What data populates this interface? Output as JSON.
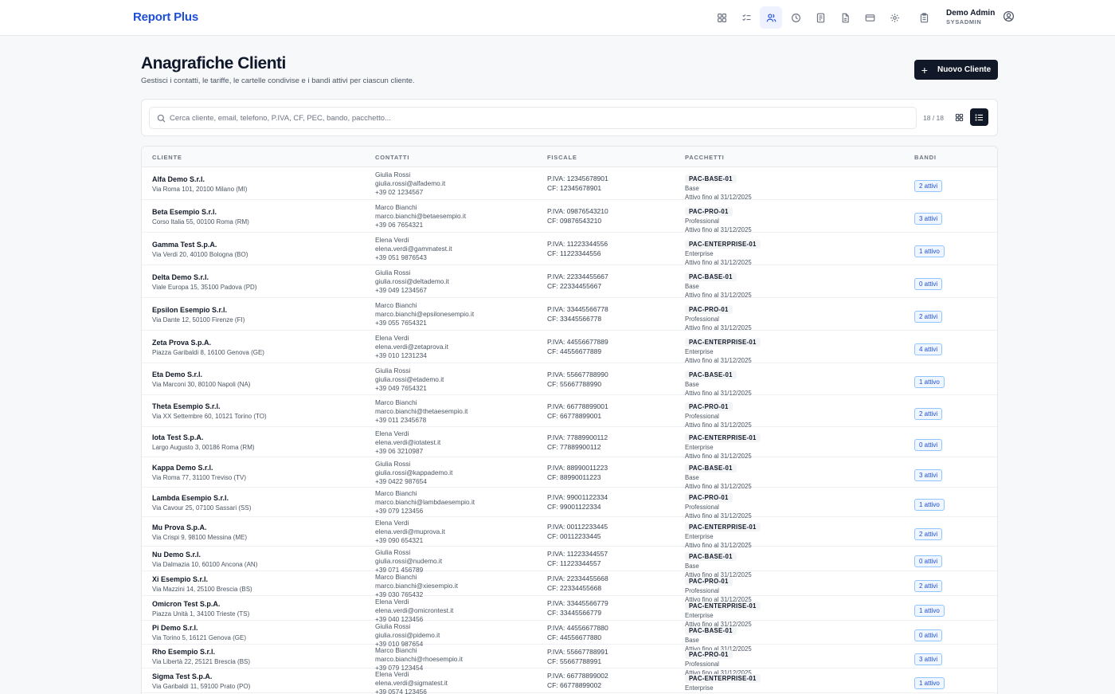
{
  "app": {
    "brand": "Report Plus",
    "user": {
      "name": "Demo Admin",
      "role": "SYSADMIN"
    },
    "nav_icons": [
      "dashboard-icon",
      "checklist-icon",
      "users-icon",
      "clock-icon",
      "document-icon",
      "file-icon",
      "card-icon",
      "gear-icon",
      "clipboard-icon"
    ],
    "active_nav": "users-icon"
  },
  "header": {
    "title": "Anagrafiche Clienti",
    "subtitle": "Gestisci i contatti, le tariffe, le cartelle condivise e i bandi attivi per ciascun cliente.",
    "new_button": "Nuovo Cliente"
  },
  "search": {
    "placeholder": "Cerca cliente, email, telefono, P.IVA, CF, PEC, bando, pacchetto...",
    "value": "",
    "count": "18 / 18",
    "view": "list"
  },
  "colors": {
    "accent": "#1d4ed8",
    "dark": "#111827",
    "badge_bg": "#eff6ff",
    "badge_border": "#93c5fd"
  },
  "table": {
    "columns": [
      "CLIENTE",
      "CONTATTI",
      "FISCALE",
      "PACCHETTI",
      "BANDI"
    ],
    "rows": [
      {
        "name": "Alfa Demo S.r.l.",
        "address": "Via Roma 101, 20100 Milano (MI)",
        "contact": "Giulia Rossi",
        "email": "giulia.rossi@alfademo.it",
        "phone": "+39 02 1234567",
        "piva": "P.IVA: 12345678901",
        "cf": "CF: 12345678901",
        "pkg_code": "PAC-BASE-01",
        "pkg_name": "Base",
        "pkg_active": "Attivo fino al 31/12/2025",
        "bandi": "2 attivi"
      },
      {
        "name": "Beta Esempio S.r.l.",
        "address": "Corso Italia 55, 00100 Roma (RM)",
        "contact": "Marco Bianchi",
        "email": "marco.bianchi@betaesempio.it",
        "phone": "+39 06 7654321",
        "piva": "P.IVA: 09876543210",
        "cf": "CF: 09876543210",
        "pkg_code": "PAC-PRO-01",
        "pkg_name": "Professional",
        "pkg_active": "Attivo fino al 31/12/2025",
        "bandi": "3 attivi"
      },
      {
        "name": "Gamma Test S.p.A.",
        "address": "Via Verdi 20, 40100 Bologna (BO)",
        "contact": "Elena Verdi",
        "email": "elena.verdi@gammatest.it",
        "phone": "+39 051 9876543",
        "piva": "P.IVA: 11223344556",
        "cf": "CF: 11223344556",
        "pkg_code": "PAC-ENTERPRISE-01",
        "pkg_name": "Enterprise",
        "pkg_active": "Attivo fino al 31/12/2025",
        "bandi": "1 attivo"
      },
      {
        "name": "Delta Demo S.r.l.",
        "address": "Viale Europa 15, 35100 Padova (PD)",
        "contact": "Giulia Rossi",
        "email": "giulia.rossi@deltademo.it",
        "phone": "+39 049 1234567",
        "piva": "P.IVA: 22334455667",
        "cf": "CF: 22334455667",
        "pkg_code": "PAC-BASE-01",
        "pkg_name": "Base",
        "pkg_active": "Attivo fino al 31/12/2025",
        "bandi": "0 attivi"
      },
      {
        "name": "Epsilon Esempio S.r.l.",
        "address": "Via Dante 12, 50100 Firenze (FI)",
        "contact": "Marco Bianchi",
        "email": "marco.bianchi@epsilonesempio.it",
        "phone": "+39 055 7654321",
        "piva": "P.IVA: 33445566778",
        "cf": "CF: 33445566778",
        "pkg_code": "PAC-PRO-01",
        "pkg_name": "Professional",
        "pkg_active": "Attivo fino al 31/12/2025",
        "bandi": "2 attivi"
      },
      {
        "name": "Zeta Prova S.p.A.",
        "address": "Piazza Garibaldi 8, 16100 Genova (GE)",
        "contact": "Elena Verdi",
        "email": "elena.verdi@zetaprova.it",
        "phone": "+39 010 1231234",
        "piva": "P.IVA: 44556677889",
        "cf": "CF: 44556677889",
        "pkg_code": "PAC-ENTERPRISE-01",
        "pkg_name": "Enterprise",
        "pkg_active": "Attivo fino al 31/12/2025",
        "bandi": "4 attivi"
      },
      {
        "name": "Eta Demo S.r.l.",
        "address": "Via Marconi 30, 80100 Napoli (NA)",
        "contact": "Giulia Rossi",
        "email": "giulia.rossi@etademo.it",
        "phone": "+39 049 7654321",
        "piva": "P.IVA: 55667788990",
        "cf": "CF: 55667788990",
        "pkg_code": "PAC-BASE-01",
        "pkg_name": "Base",
        "pkg_active": "Attivo fino al 31/12/2025",
        "bandi": "1 attivo"
      },
      {
        "name": "Theta Esempio S.r.l.",
        "address": "Via XX Settembre 60, 10121 Torino (TO)",
        "contact": "Marco Bianchi",
        "email": "marco.bianchi@thetaesempio.it",
        "phone": "+39 011 2345678",
        "piva": "P.IVA: 66778899001",
        "cf": "CF: 66778899001",
        "pkg_code": "PAC-PRO-01",
        "pkg_name": "Professional",
        "pkg_active": "Attivo fino al 31/12/2025",
        "bandi": "2 attivi"
      },
      {
        "name": "Iota Test S.p.A.",
        "address": "Largo Augusto 3, 00186 Roma (RM)",
        "contact": "Elena Verdi",
        "email": "elena.verdi@iotatest.it",
        "phone": "+39 06 3210987",
        "piva": "P.IVA: 77889900112",
        "cf": "CF: 77889900112",
        "pkg_code": "PAC-ENTERPRISE-01",
        "pkg_name": "Enterprise",
        "pkg_active": "Attivo fino al 31/12/2025",
        "bandi": "0 attivi"
      },
      {
        "name": "Kappa Demo S.r.l.",
        "address": "Via Roma 77, 31100 Treviso (TV)",
        "contact": "Giulia Rossi",
        "email": "giulia.rossi@kappademo.it",
        "phone": "+39 0422 987654",
        "piva": "P.IVA: 88990011223",
        "cf": "CF: 88990011223",
        "pkg_code": "PAC-BASE-01",
        "pkg_name": "Base",
        "pkg_active": "Attivo fino al 31/12/2025",
        "bandi": "3 attivi"
      },
      {
        "name": "Lambda Esempio S.r.l.",
        "address": "Via Cavour 25, 07100 Sassari (SS)",
        "contact": "Marco Bianchi",
        "email": "marco.bianchi@lambdaesempio.it",
        "phone": "+39 079 123456",
        "piva": "P.IVA: 99001122334",
        "cf": "CF: 99001122334",
        "pkg_code": "PAC-PRO-01",
        "pkg_name": "Professional",
        "pkg_active": "Attivo fino al 31/12/2025",
        "bandi": "1 attivo"
      },
      {
        "name": "Mu Prova S.p.A.",
        "address": "Via Crispi 9, 98100 Messina (ME)",
        "contact": "Elena Verdi",
        "email": "elena.verdi@muprova.it",
        "phone": "+39 090 654321",
        "piva": "P.IVA: 00112233445",
        "cf": "CF: 00112233445",
        "pkg_code": "PAC-ENTERPRISE-01",
        "pkg_name": "Enterprise",
        "pkg_active": "Attivo fino al 31/12/2025",
        "bandi": "2 attivi"
      },
      {
        "name": "Nu Demo S.r.l.",
        "address": "Via Dalmazia 10, 60100 Ancona (AN)",
        "contact": "Giulia Rossi",
        "email": "giulia.rossi@nudemo.it",
        "phone": "+39 071 456789",
        "piva": "P.IVA: 11223344557",
        "cf": "CF: 11223344557",
        "pkg_code": "PAC-BASE-01",
        "pkg_name": "Base",
        "pkg_active": "Attivo fino al 31/12/2025",
        "bandi": "0 attivi"
      },
      {
        "name": "Xi Esempio S.r.l.",
        "address": "Via Mazzini 14, 25100 Brescia (BS)",
        "contact": "Marco Bianchi",
        "email": "marco.bianchi@xiesempio.it",
        "phone": "+39 030 765432",
        "piva": "P.IVA: 22334455668",
        "cf": "CF: 22334455668",
        "pkg_code": "PAC-PRO-01",
        "pkg_name": "Professional",
        "pkg_active": "Attivo fino al 31/12/2025",
        "bandi": "2 attivi"
      },
      {
        "name": "Omicron Test S.p.A.",
        "address": "Piazza Unità 1, 34100 Trieste (TS)",
        "contact": "Elena Verdi",
        "email": "elena.verdi@omicrontest.it",
        "phone": "+39 040 123456",
        "piva": "P.IVA: 33445566779",
        "cf": "CF: 33445566779",
        "pkg_code": "PAC-ENTERPRISE-01",
        "pkg_name": "Enterprise",
        "pkg_active": "Attivo fino al 31/12/2025",
        "bandi": "1 attivo"
      },
      {
        "name": "Pi Demo S.r.l.",
        "address": "Via Torino 5, 16121 Genova (GE)",
        "contact": "Giulia Rossi",
        "email": "giulia.rossi@pidemo.it",
        "phone": "+39 010 987654",
        "piva": "P.IVA: 44556677880",
        "cf": "CF: 44556677880",
        "pkg_code": "PAC-BASE-01",
        "pkg_name": "Base",
        "pkg_active": "Attivo fino al 31/12/2025",
        "bandi": "0 attivi"
      },
      {
        "name": "Rho Esempio S.r.l.",
        "address": "Via Libertà 22, 25121 Brescia (BS)",
        "contact": "Marco Bianchi",
        "email": "marco.bianchi@rhoesempio.it",
        "phone": "+39 079 123454",
        "piva": "P.IVA: 55667788991",
        "cf": "CF: 55667788991",
        "pkg_code": "PAC-PRO-01",
        "pkg_name": "Professional",
        "pkg_active": "Attivo fino al 31/12/2025",
        "bandi": "3 attivi"
      },
      {
        "name": "Sigma Test S.p.A.",
        "address": "Via Garibaldi 11, 59100 Prato (PO)",
        "contact": "Elena Verdi",
        "email": "elena.verdi@sigmatest.it",
        "phone": "+39 0574 123456",
        "piva": "P.IVA: 66778899002",
        "cf": "CF: 66778899002",
        "pkg_code": "PAC-ENTERPRISE-01",
        "pkg_name": "Enterprise",
        "pkg_active": "Attivo fino al 31/12/2025",
        "bandi": "1 attivo"
      }
    ]
  }
}
